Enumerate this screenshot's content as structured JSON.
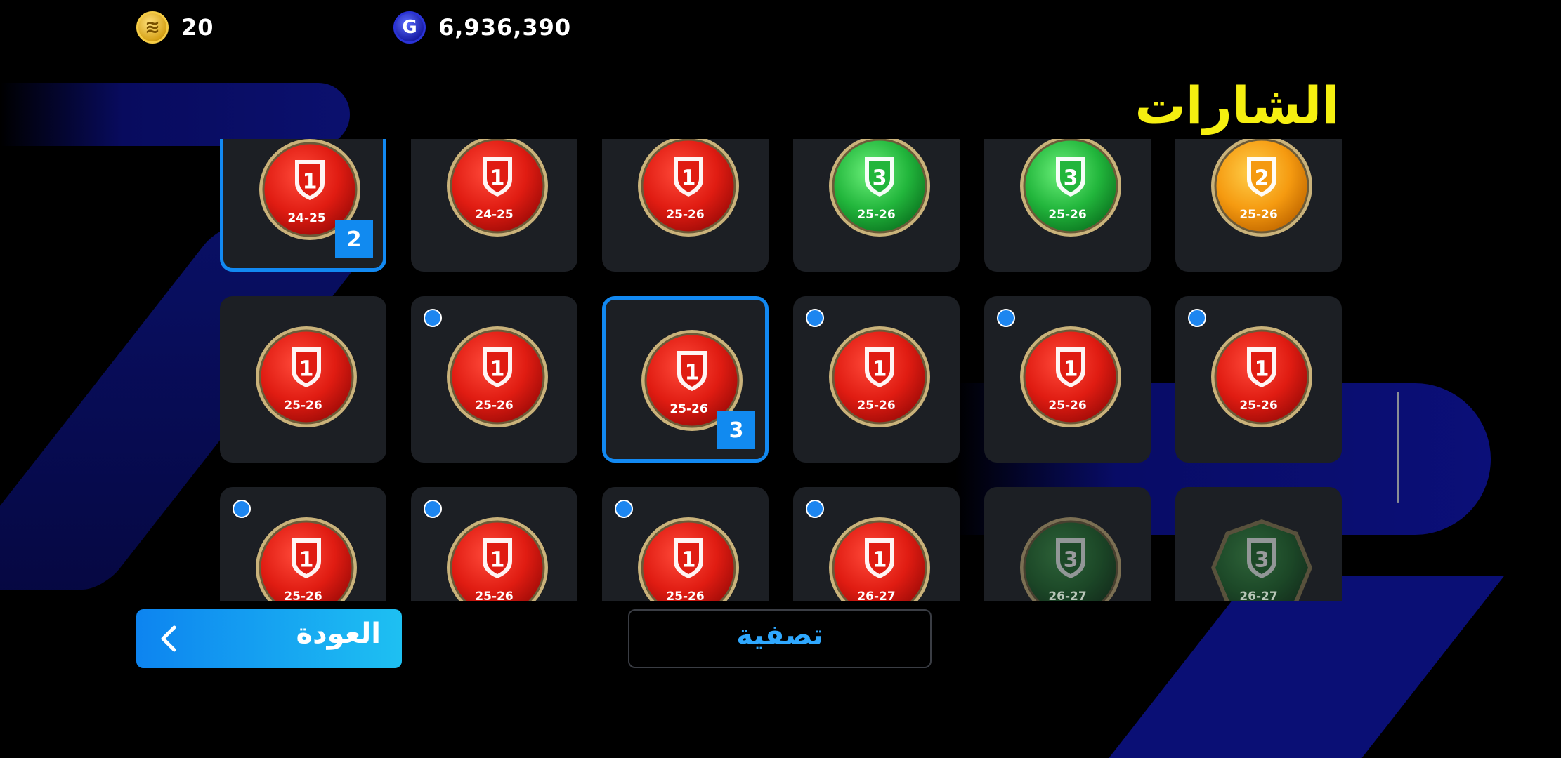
{
  "currencies": {
    "coins": {
      "icon": "efootball-coin-icon",
      "symbol": "≋",
      "value": "20",
      "color": "#e8b52a"
    },
    "gp": {
      "icon": "gp-coin-icon",
      "symbol": "G",
      "value": "6,936,390",
      "color": "#2a33d8"
    }
  },
  "page": {
    "title": "الشارات"
  },
  "badges": [
    {
      "rank": "1",
      "season": "24-25",
      "color": "red",
      "selected": true,
      "count": "2",
      "new": false,
      "faded": false
    },
    {
      "rank": "1",
      "season": "24-25",
      "color": "red",
      "selected": false,
      "count": "",
      "new": false,
      "faded": false
    },
    {
      "rank": "1",
      "season": "25-26",
      "color": "red",
      "selected": false,
      "count": "",
      "new": false,
      "faded": false
    },
    {
      "rank": "3",
      "season": "25-26",
      "color": "green",
      "selected": false,
      "count": "",
      "new": false,
      "faded": false
    },
    {
      "rank": "3",
      "season": "25-26",
      "color": "green",
      "selected": false,
      "count": "",
      "new": false,
      "faded": false
    },
    {
      "rank": "2",
      "season": "25-26",
      "color": "orange",
      "selected": false,
      "count": "",
      "new": false,
      "faded": false
    },
    {
      "rank": "1",
      "season": "25-26",
      "color": "red",
      "selected": false,
      "count": "",
      "new": false,
      "faded": false
    },
    {
      "rank": "1",
      "season": "25-26",
      "color": "red",
      "selected": false,
      "count": "",
      "new": true,
      "faded": false
    },
    {
      "rank": "1",
      "season": "25-26",
      "color": "red",
      "selected": true,
      "count": "3",
      "new": false,
      "faded": false
    },
    {
      "rank": "1",
      "season": "25-26",
      "color": "red",
      "selected": false,
      "count": "",
      "new": true,
      "faded": false
    },
    {
      "rank": "1",
      "season": "25-26",
      "color": "red",
      "selected": false,
      "count": "",
      "new": true,
      "faded": false
    },
    {
      "rank": "1",
      "season": "25-26",
      "color": "red",
      "selected": false,
      "count": "",
      "new": true,
      "faded": false
    },
    {
      "rank": "1",
      "season": "25-26",
      "color": "red",
      "selected": false,
      "count": "",
      "new": true,
      "faded": false
    },
    {
      "rank": "1",
      "season": "25-26",
      "color": "red",
      "selected": false,
      "count": "",
      "new": true,
      "faded": false
    },
    {
      "rank": "1",
      "season": "25-26",
      "color": "red",
      "selected": false,
      "count": "",
      "new": true,
      "faded": false
    },
    {
      "rank": "1",
      "season": "26-27",
      "color": "red",
      "selected": false,
      "count": "",
      "new": true,
      "faded": false
    },
    {
      "rank": "3",
      "season": "26-27",
      "color": "darkgreen",
      "selected": false,
      "count": "",
      "new": false,
      "faded": true
    },
    {
      "rank": "3",
      "season": "26-27",
      "color": "darkgreen-octagon",
      "selected": false,
      "count": "",
      "new": false,
      "faded": true
    }
  ],
  "palette": {
    "red": {
      "light": "#ff4a3a",
      "mid": "#e01c12",
      "dark": "#a30c08"
    },
    "green": {
      "light": "#6cf07a",
      "mid": "#22b63c",
      "dark": "#0d7a22"
    },
    "orange": {
      "light": "#ffcf4a",
      "mid": "#f59a10",
      "dark": "#c46a00"
    },
    "darkgreen": {
      "light": "#3d9a4a",
      "mid": "#1d6a2b",
      "dark": "#0e3d18"
    },
    "darkgreen-octagon": {
      "light": "#3d9a4a",
      "mid": "#1d6a2b",
      "dark": "#0e3d18"
    }
  },
  "footer": {
    "back_label": "العودة",
    "back_icon": "chevron-left-icon",
    "filter_label": "تصفية"
  }
}
